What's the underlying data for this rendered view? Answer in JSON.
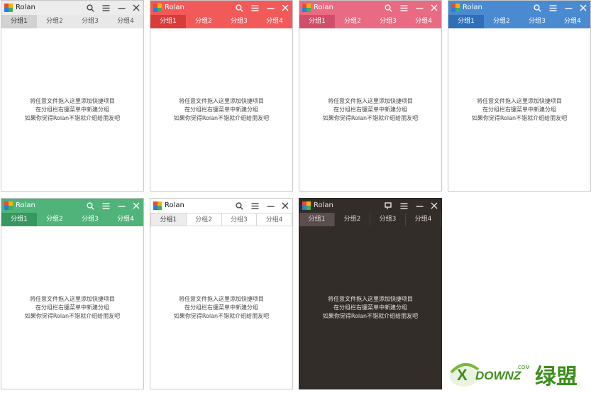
{
  "app_title": "Rolan",
  "tabs": [
    "分组1",
    "分组2",
    "分组3",
    "分组4"
  ],
  "message": [
    "将任意文件拖入这里添加快捷项目",
    "在分组栏右键菜单中新建分组",
    "如果你觉得Rolan不错就介绍给朋友吧"
  ],
  "icons": {
    "search": "search-icon",
    "menu": "menu-icon",
    "minimize": "minimize-icon",
    "close": "close-icon",
    "pin": "pin-icon"
  },
  "themes": [
    {
      "name": "gray",
      "accent": "#ececec"
    },
    {
      "name": "red",
      "accent": "#f25a5a"
    },
    {
      "name": "pink",
      "accent": "#e86a83"
    },
    {
      "name": "blue",
      "accent": "#4a8ad0"
    },
    {
      "name": "green",
      "accent": "#4fb37a"
    },
    {
      "name": "white",
      "accent": "#ffffff"
    },
    {
      "name": "dark",
      "accent": "#332d29"
    }
  ],
  "watermark": {
    "brand": "DOWNZ",
    "suffix": ".COM",
    "cn": "绿盟"
  }
}
